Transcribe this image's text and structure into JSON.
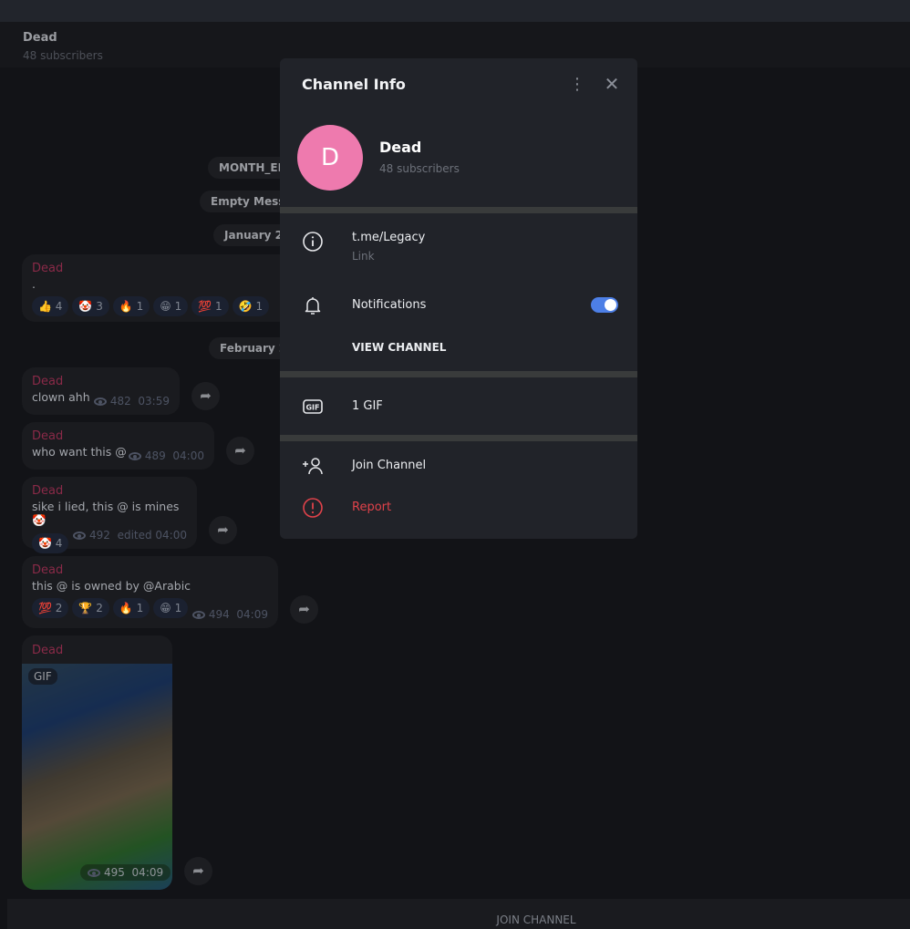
{
  "chat": {
    "title": "Dead",
    "subscribers": "48 subscribers"
  },
  "date_pills": [
    "MONTH_EF",
    "Empty Messa",
    "January 27",
    "February 2"
  ],
  "messages": [
    {
      "author": "Dead",
      "text": ".",
      "reactions": [
        {
          "emoji": "👍",
          "count": "4"
        },
        {
          "emoji": "🤡",
          "count": "3"
        },
        {
          "emoji": "🔥",
          "count": "1"
        },
        {
          "emoji": "😁",
          "count": "1"
        },
        {
          "emoji": "💯",
          "count": "1"
        },
        {
          "emoji": "🤣",
          "count": "1"
        }
      ]
    },
    {
      "author": "Dead",
      "text": "clown ahh",
      "views": "482",
      "time": "03:59"
    },
    {
      "author": "Dead",
      "text": "who want this @",
      "views": "489",
      "time": "04:00"
    },
    {
      "author": "Dead",
      "text": "sike i lied, this @ is mines 🤡",
      "reactions": [
        {
          "emoji": "🤡",
          "count": "4"
        }
      ],
      "views": "492",
      "time": "edited 04:00"
    },
    {
      "author": "Dead",
      "text": "this @ is owned by @Arabic",
      "reactions": [
        {
          "emoji": "💯",
          "count": "2"
        },
        {
          "emoji": "🏆",
          "count": "2"
        },
        {
          "emoji": "🔥",
          "count": "1"
        },
        {
          "emoji": "😁",
          "count": "1"
        }
      ],
      "views": "494",
      "time": "04:09"
    },
    {
      "author": "Dead",
      "badge": "GIF",
      "views": "495",
      "time": "04:09"
    }
  ],
  "bottom": {
    "join_label": "JOIN CHANNEL"
  },
  "modal": {
    "title": "Channel Info",
    "avatar_letter": "D",
    "avatar_color": "#ee7aae",
    "name": "Dead",
    "subscribers": "48 subscribers",
    "link": {
      "value": "t.me/Legacy",
      "label": "Link"
    },
    "notifications": {
      "label": "Notifications",
      "enabled": true
    },
    "view_channel": "VIEW CHANNEL",
    "gif_count": "1 GIF",
    "join": "Join Channel",
    "report": "Report",
    "accent": "#4d7fe6",
    "danger": "#e0424a"
  }
}
